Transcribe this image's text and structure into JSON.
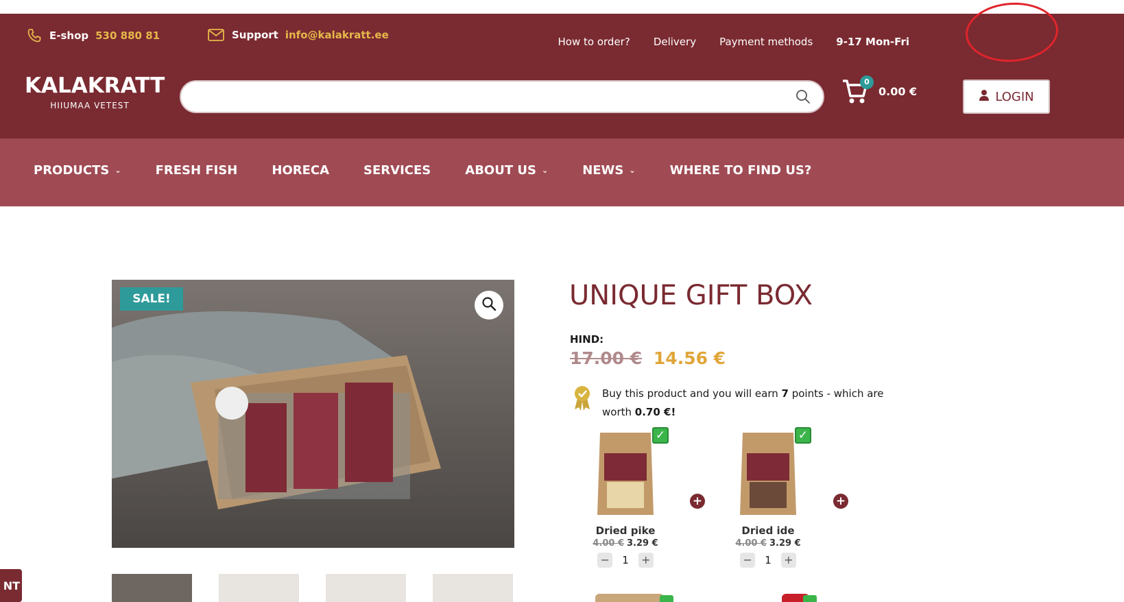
{
  "topbar": {
    "eshop_label": "E-shop",
    "eshop_phone": "530 880 81",
    "support_label": "Support",
    "support_email": "info@kalakratt.ee",
    "links": [
      "How to order?",
      "Delivery",
      "Payment methods"
    ],
    "hours": "9-17 Mon-Fri"
  },
  "logo": {
    "brand": "KALAKRATT",
    "tagline": "HIIUMAA VETEST"
  },
  "search": {
    "placeholder": "",
    "value": ""
  },
  "cart": {
    "count": "0",
    "total": "0.00 €"
  },
  "login": {
    "label": "LOGIN"
  },
  "nav": {
    "items": [
      {
        "label": "PRODUCTS",
        "has_dropdown": true
      },
      {
        "label": "FRESH FISH",
        "has_dropdown": false
      },
      {
        "label": "HORECA",
        "has_dropdown": false
      },
      {
        "label": "SERVICES",
        "has_dropdown": false
      },
      {
        "label": "ABOUT US",
        "has_dropdown": true
      },
      {
        "label": "NEWS",
        "has_dropdown": true
      },
      {
        "label": "WHERE TO FIND US?",
        "has_dropdown": false
      }
    ]
  },
  "product": {
    "sale_badge": "SALE!",
    "title": "UNIQUE GIFT BOX",
    "price_label": "HIND:",
    "old_price": "17.00 €",
    "new_price": "14.56 €",
    "points_text_1": "Buy this product and you will earn",
    "points_value": "7",
    "points_text_2": "points - which are worth",
    "points_worth": "0.70 €",
    "points_end": "!"
  },
  "bundle": [
    {
      "name": "Dried pike",
      "old_price": "4.00 €",
      "price": "3.29 €",
      "qty": "1",
      "checked": true
    },
    {
      "name": "Dried ide",
      "old_price": "4.00 €",
      "price": "3.29 €",
      "qty": "1",
      "checked": true
    }
  ],
  "side_tab": {
    "label": "NT"
  },
  "colors": {
    "header_bg": "#7a2a31",
    "nav_bg": "#a04b54",
    "accent_gold": "#e0a63a",
    "teal": "#2e9a9a",
    "annotation_red": "#e0242b"
  },
  "icons": [
    "phone-icon",
    "mail-icon",
    "search-icon",
    "cart-icon",
    "user-icon",
    "zoom-icon",
    "award-icon",
    "check-icon",
    "plus-icon",
    "minus-icon",
    "chevron-down-icon"
  ]
}
